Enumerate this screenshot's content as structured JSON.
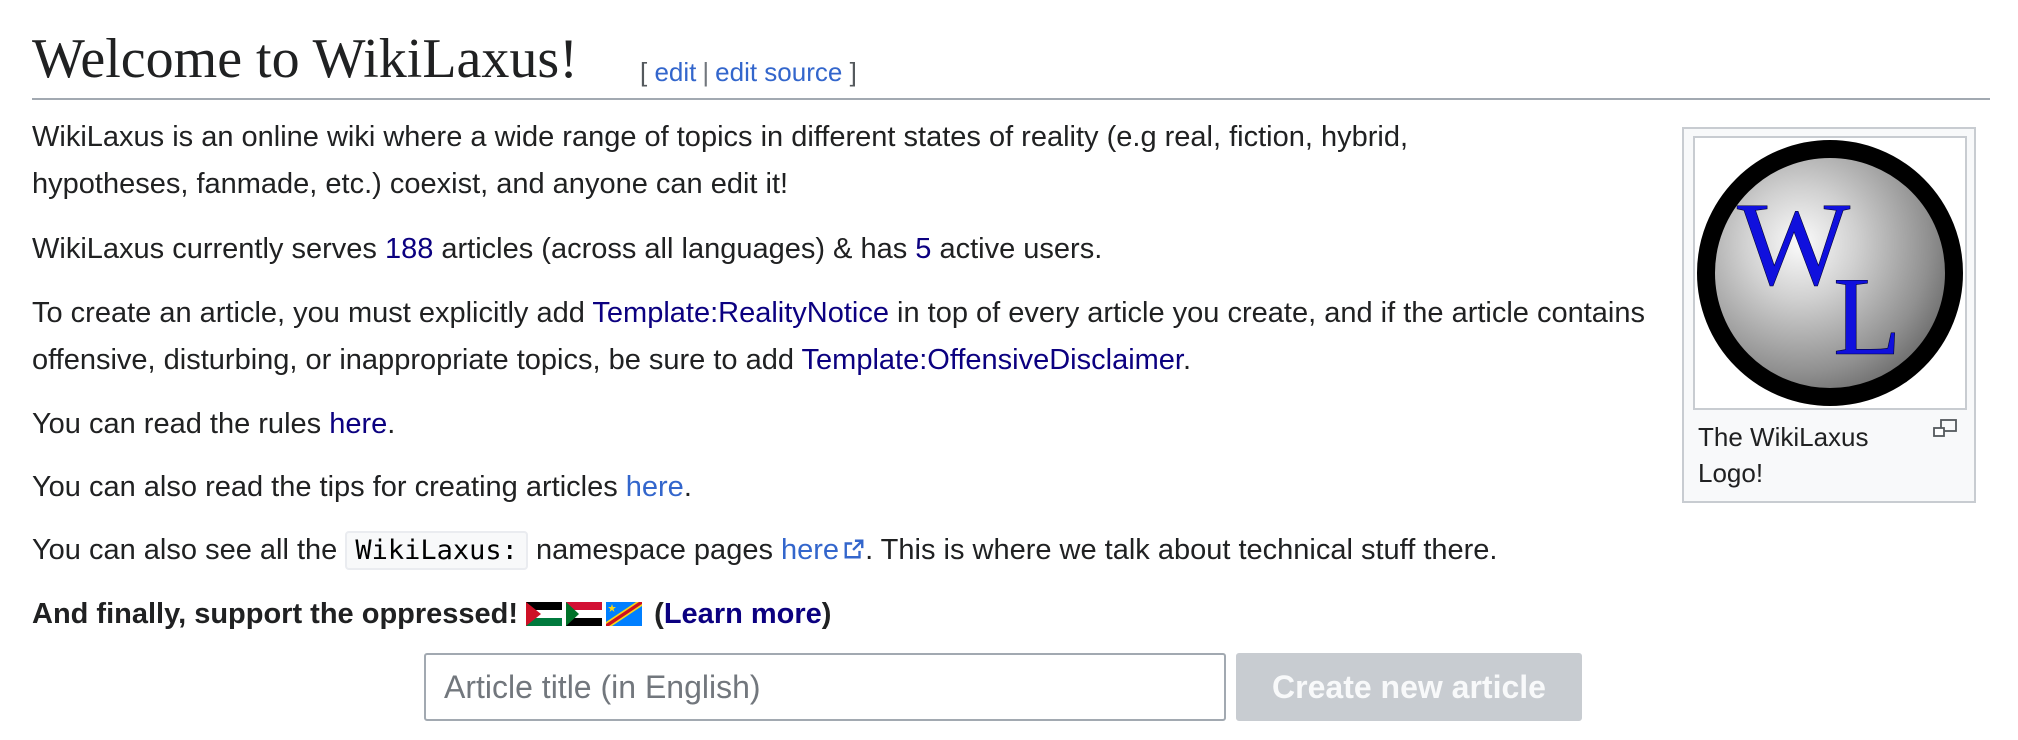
{
  "heading": {
    "title": "Welcome to WikiLaxus!",
    "bracket_open": "[",
    "edit_label": "edit",
    "separator": "|",
    "edit_source_label": "edit source",
    "bracket_close": "]"
  },
  "intro": {
    "text": "WikiLaxus is an online wiki where a wide range of topics in different states of reality (e.g real, fiction, hybrid, hypotheses, fanmade, etc.) coexist, and anyone can edit it!"
  },
  "stats": {
    "prefix": "WikiLaxus currently serves ",
    "articles_count": "188",
    "middle": " articles (across all languages) & has ",
    "users_count": "5",
    "suffix": " active users."
  },
  "create_info": {
    "prefix": "To create an article, you must explicitly add ",
    "template1": "Template:RealityNotice",
    "middle": " in top of every article you create, and if the article contains offensive, disturbing, or inappropriate topics, be sure to add ",
    "template2": "Template:OffensiveDisclaimer",
    "suffix": "."
  },
  "rules": {
    "prefix": "You can read the rules ",
    "link": "here",
    "suffix": "."
  },
  "tips": {
    "prefix": "You can also read the tips for creating articles ",
    "link": "here",
    "suffix": "."
  },
  "namespace": {
    "prefix": "You can also see all the ",
    "code": "WikiLaxus:",
    "middle": " namespace pages ",
    "link": "here",
    "suffix": ". This is where we talk about technical stuff there."
  },
  "support": {
    "text": "And finally, support the oppressed!",
    "flags": [
      "palestine-flag",
      "sudan-flag",
      "congo-flag"
    ],
    "paren_open": " (",
    "link": "Learn more",
    "paren_close": ")"
  },
  "thumbnail": {
    "logo_letter1": "W",
    "logo_letter2": "L",
    "caption": "The WikiLaxus Logo!",
    "icon": "magnify-icon"
  },
  "create_form": {
    "placeholder": "Article title (in English)",
    "button_label": "Create new article"
  },
  "colors": {
    "link": "#3366cc",
    "visited_link": "#0b0080",
    "logo_letters": "#1010dd"
  }
}
